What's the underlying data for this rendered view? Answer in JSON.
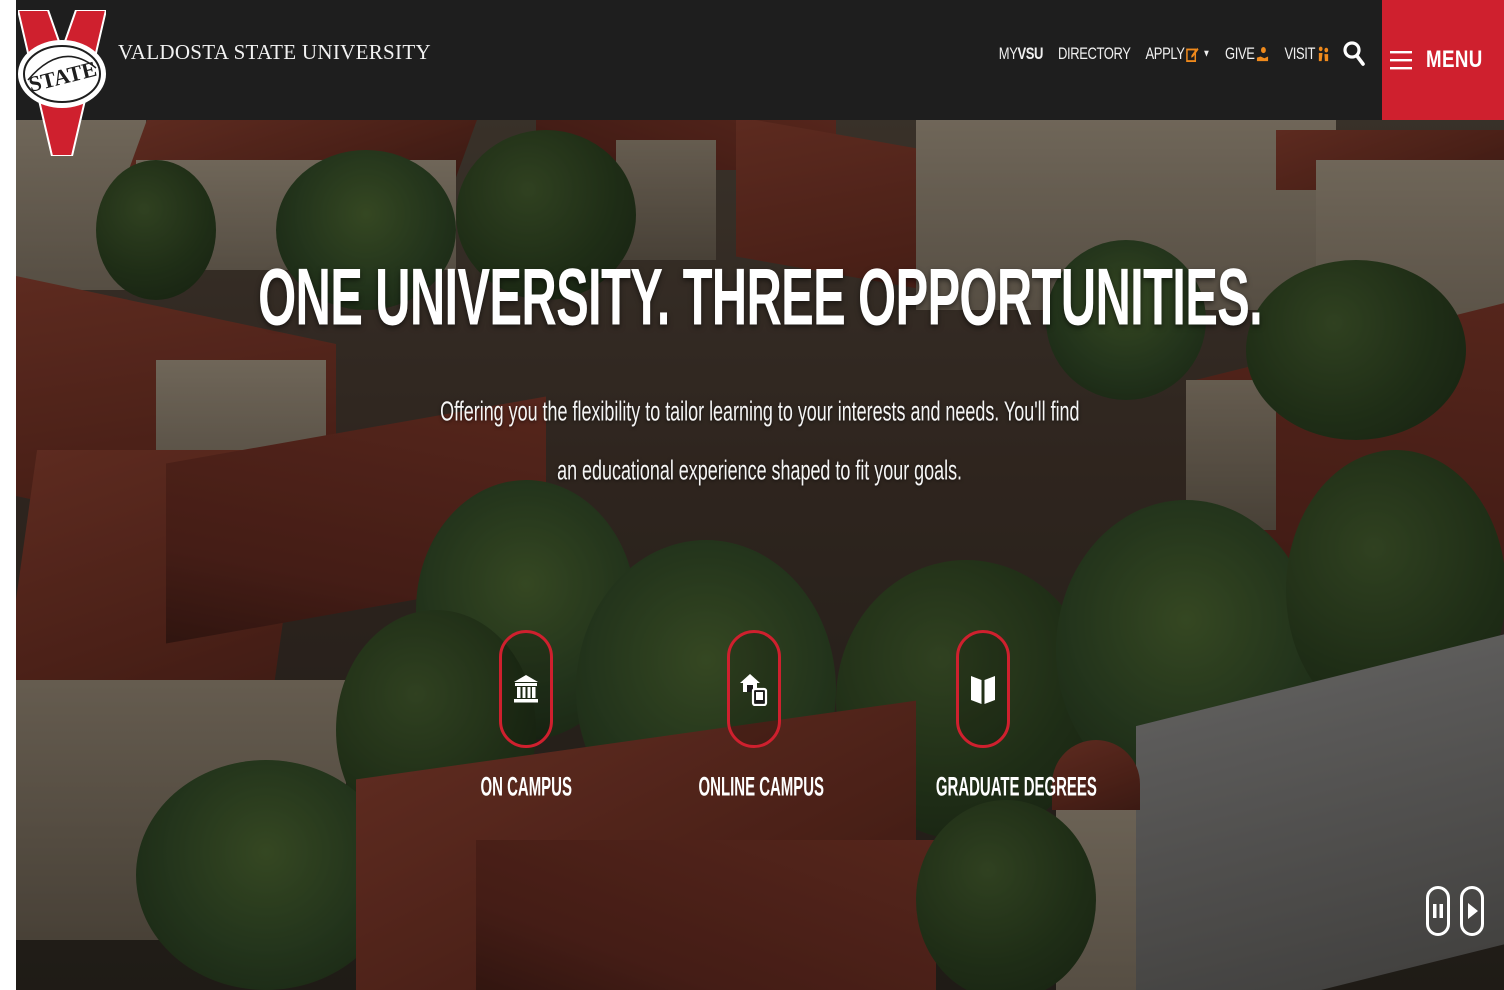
{
  "header": {
    "university_name": "VALDOSTA STATE UNIVERSITY",
    "logo_text": "STATE",
    "logo_letter": "V",
    "nav": {
      "myvsu_prefix": "MY",
      "myvsu_bold": "VSU",
      "directory": "DIRECTORY",
      "apply": "APPLY",
      "give": "GIVE",
      "visit": "VISIT"
    },
    "menu_label": "MENU",
    "colors": {
      "header_bg": "#1e1e1e",
      "accent_red": "#cf202e",
      "icon_orange": "#f08a1c"
    }
  },
  "hero": {
    "title": "ONE UNIVERSITY. THREE OPPORTUNITIES.",
    "subtitle_line1": "Offering you the flexibility to tailor learning to your interests and needs. You'll find",
    "subtitle_line2": "an educational experience shaped to fit your goals.",
    "pathways": [
      {
        "label": "ON CAMPUS",
        "icon": "building-columns-icon"
      },
      {
        "label": "ONLINE CAMPUS",
        "icon": "house-device-icon"
      },
      {
        "label": "GRADUATE DEGREES",
        "icon": "open-book-icon"
      }
    ],
    "controls": {
      "pause": "pause-icon",
      "play": "play-icon"
    }
  }
}
